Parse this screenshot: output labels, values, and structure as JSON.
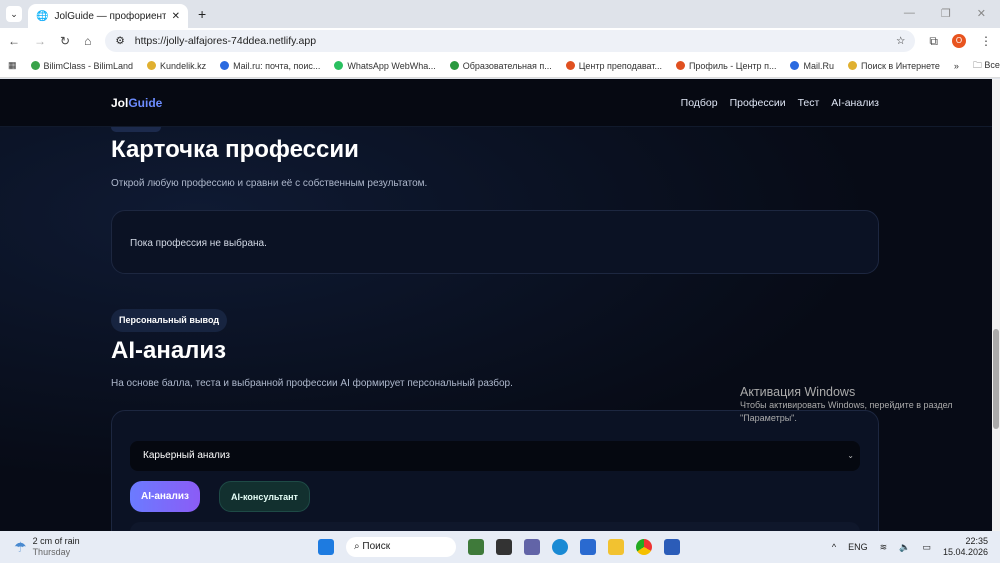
{
  "browser": {
    "tab_title": "JolGuide — профориентация",
    "url": "https://jolly-alfajores-74ddea.netlify.app",
    "bookmarks": [
      {
        "label": "BilimClass - BilimLand",
        "color": "#3aa34a"
      },
      {
        "label": "Kundelik.kz",
        "color": "#e0b030"
      },
      {
        "label": "Mail.ru: почта, поис...",
        "color": "#2a6ae0"
      },
      {
        "label": "WhatsApp WebWha...",
        "color": "#2ac060"
      },
      {
        "label": "Образовательная п...",
        "color": "#2a9a40"
      },
      {
        "label": "Центр преподават...",
        "color": "#e05020"
      },
      {
        "label": "Профиль - Центр п...",
        "color": "#e05020"
      },
      {
        "label": "Mail.Ru",
        "color": "#2a6ae0"
      },
      {
        "label": "Поиск в Интернете",
        "color": "#e0b030"
      }
    ],
    "all_bookmarks": "Все закладки",
    "profile_initial": "O"
  },
  "site": {
    "logo_a": "Jol",
    "logo_b": "Guide",
    "nav": [
      "Подбор",
      "Профессии",
      "Тест",
      "AI-анализ"
    ]
  },
  "profession": {
    "title": "Карточка профессии",
    "subtitle": "Открой любую профессию и сравни её с собственным результатом.",
    "empty": "Пока профессия не выбрана."
  },
  "ai": {
    "badge": "Персональный вывод",
    "title": "AI-анализ",
    "subtitle": "На основе балла, теста и выбранной профессии AI формирует персональный разбор.",
    "select_value": "Карьерный анализ",
    "btn_analysis": "AI-анализ",
    "btn_consultant": "AI-консультант"
  },
  "watermark": {
    "title": "Активация Windows",
    "text": "Чтобы активировать Windows, перейдите в раздел \"Параметры\"."
  },
  "taskbar": {
    "weather": "2 cm of rain",
    "day": "Thursday",
    "search": "Поиск",
    "lang": "ENG",
    "time": "22:35",
    "date": "15.04.2026"
  }
}
